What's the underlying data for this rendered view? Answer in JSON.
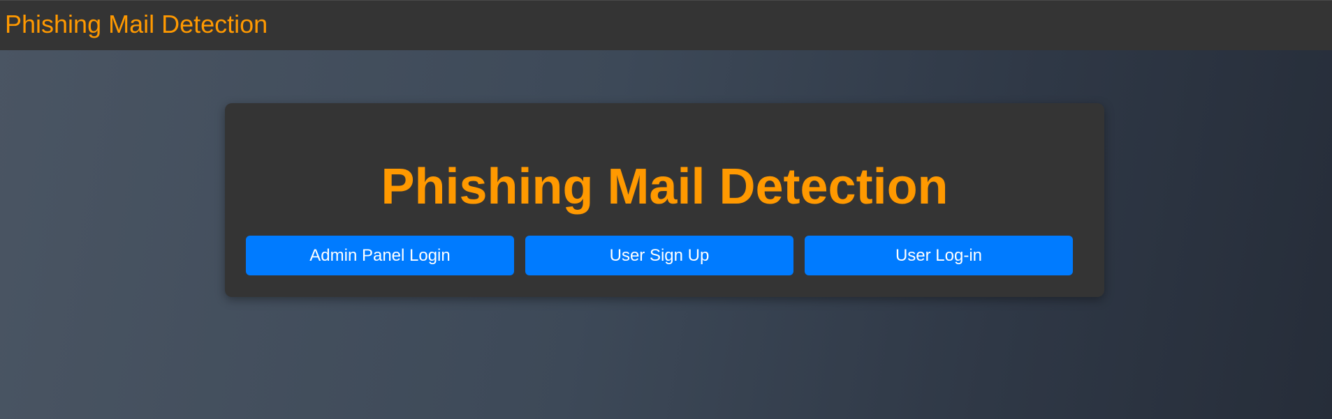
{
  "header": {
    "brand": "Phishing Mail Detection"
  },
  "main": {
    "title": "Phishing Mail Detection",
    "buttons": [
      {
        "label": "Admin Panel Login"
      },
      {
        "label": "User Sign Up"
      },
      {
        "label": "User Log-in"
      }
    ]
  },
  "colors": {
    "accent": "#ff9900",
    "button": "#007bff",
    "panel": "#343434"
  }
}
